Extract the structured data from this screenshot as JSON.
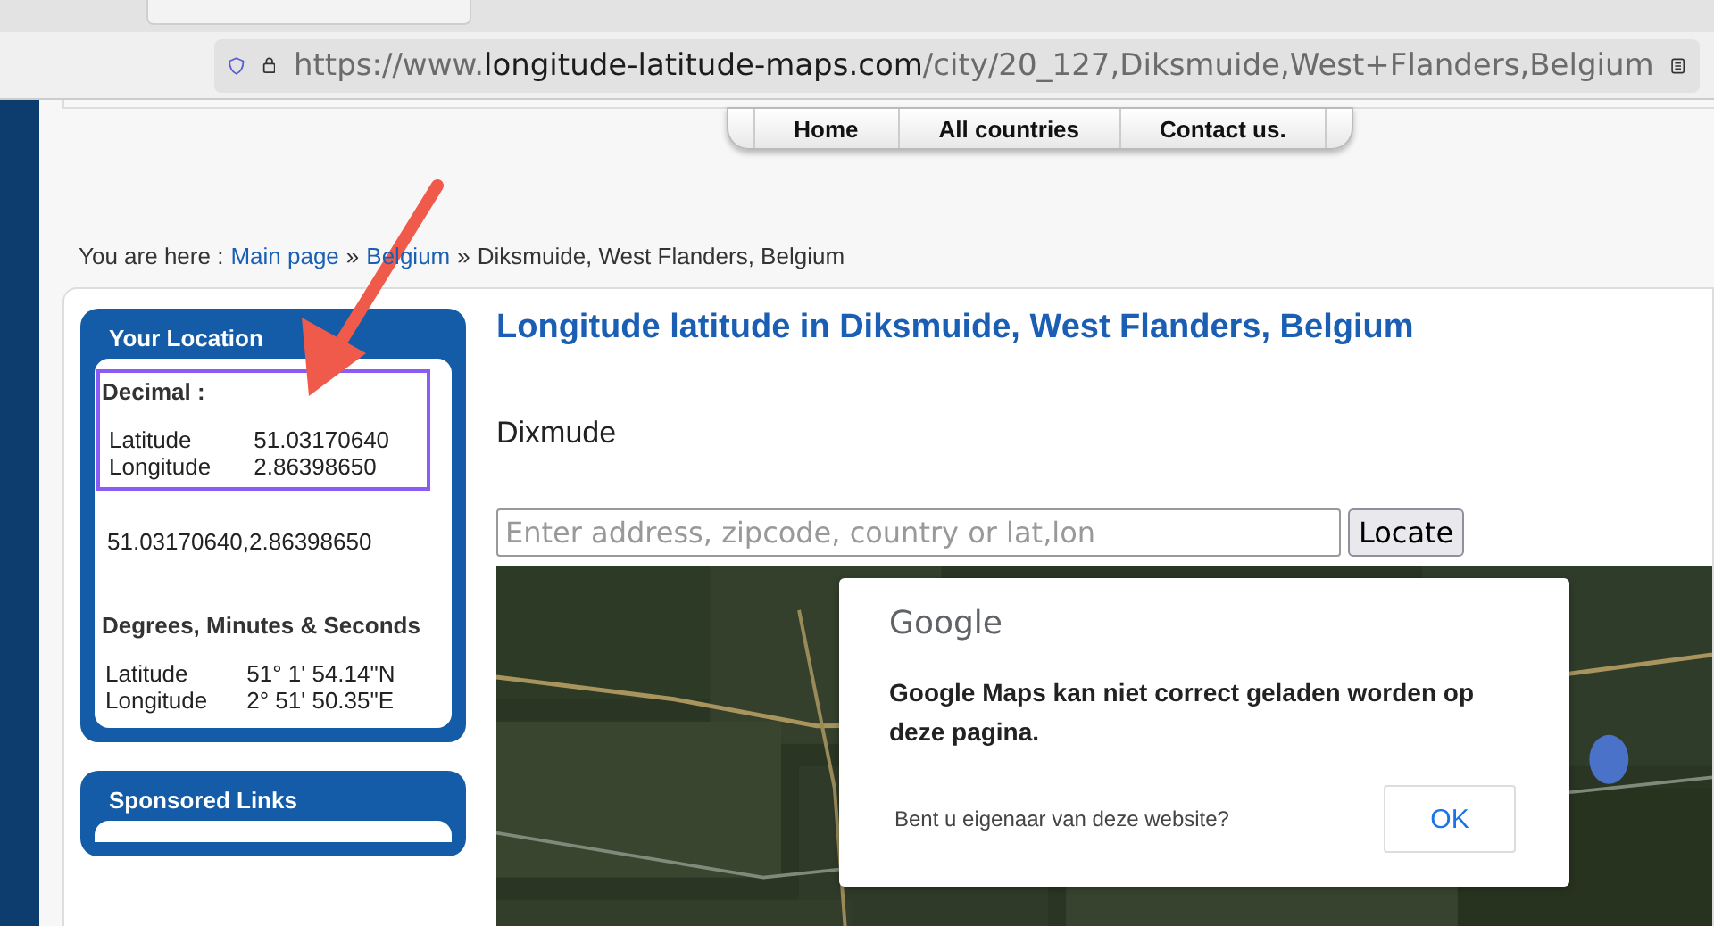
{
  "browser": {
    "url_scheme": "https://www.",
    "url_domain": "longitude-latitude-maps.com",
    "url_path": "/city/20_127,Diksmuide,West+Flanders,Belgium"
  },
  "nav": [
    "Home",
    "All countries",
    "Contact us."
  ],
  "breadcrumb": {
    "prefix": "You are here :",
    "separator": "»",
    "links": [
      "Main page",
      "Belgium"
    ],
    "current": "Diksmuide, West Flanders, Belgium"
  },
  "sidebar": {
    "location": {
      "title": "Your Location",
      "decimal_heading": "Decimal :",
      "decimal_rows": [
        {
          "label": "Latitude",
          "value": "51.03170640"
        },
        {
          "label": "Longitude",
          "value": "2.86398650"
        }
      ],
      "combined": "51.03170640,2.86398650",
      "dms_heading": "Degrees, Minutes & Seconds",
      "dms_rows": [
        {
          "label": "Latitude",
          "value": "51° 1' 54.14\"N"
        },
        {
          "label": "Longitude",
          "value": "2° 51' 50.35\"E"
        }
      ]
    },
    "sponsored": {
      "title": "Sponsored Links"
    }
  },
  "main": {
    "title": "Longitude latitude in Diksmuide, West Flanders, Belgium",
    "subtitle": "Dixmude",
    "search": {
      "placeholder": "Enter address, zipcode, country or lat,lon"
    },
    "locate_button": "Locate",
    "map": {
      "kind": "picture",
      "dialog": {
        "logo": "Google",
        "message": "Google Maps kan niet correct geladen worden op deze pagina.",
        "question": "Bent u eigenaar van deze website?",
        "button": "OK"
      }
    }
  }
}
